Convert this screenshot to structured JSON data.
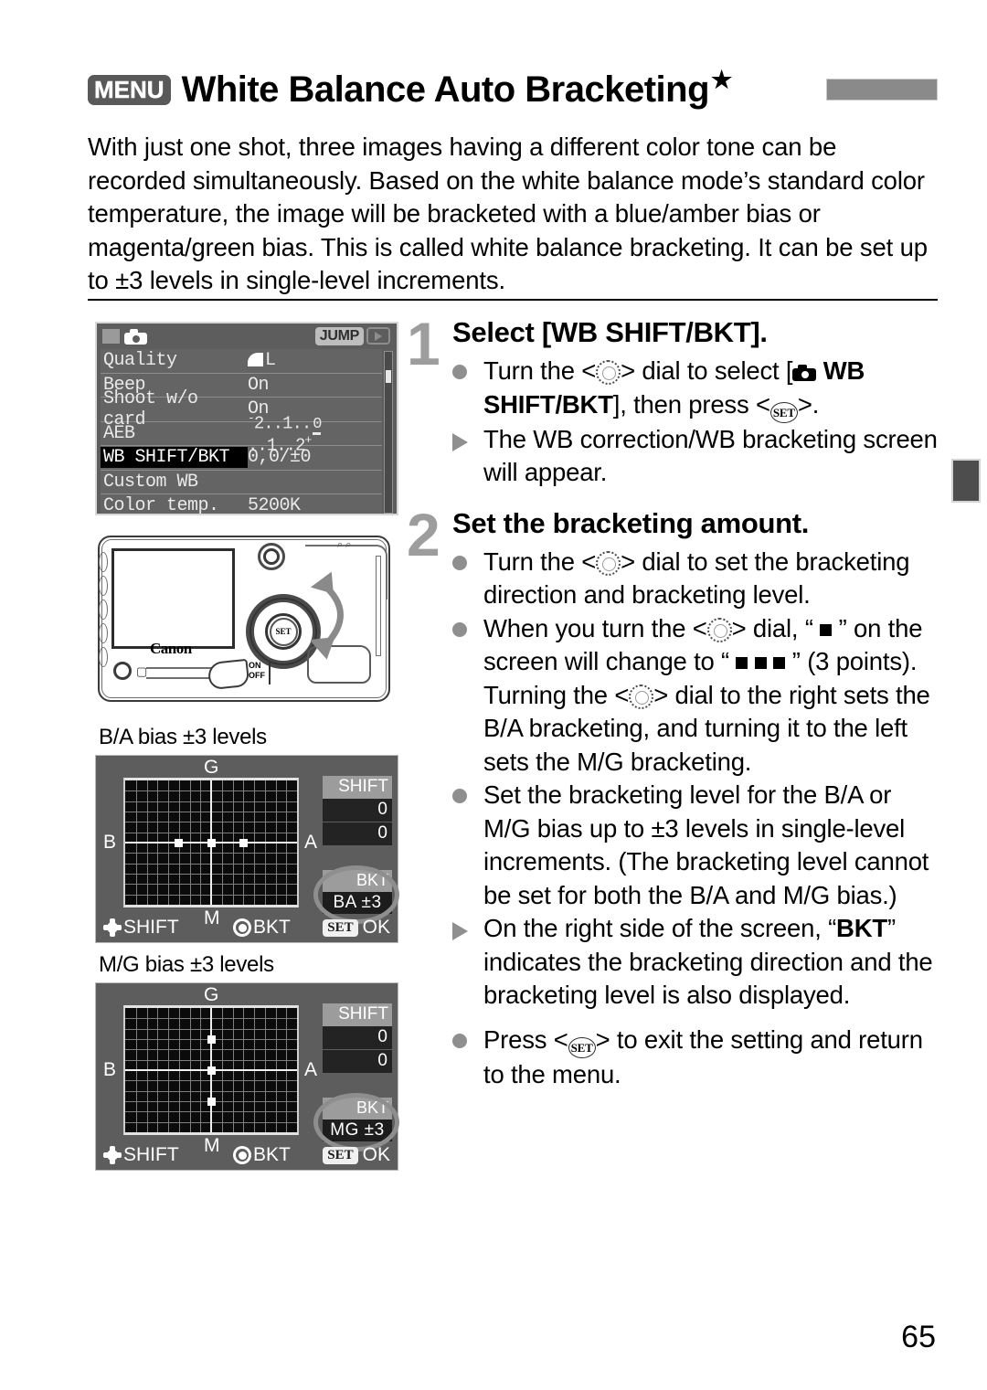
{
  "header": {
    "menu_badge": "MENU",
    "title": "White Balance Auto Bracketing",
    "star": "★"
  },
  "intro": "With just one shot, three images having a different color tone can be recorded simultaneously. Based on the white balance mode’s standard color temperature, the image will be bracketed with a blue/amber bias or magenta/green bias. This is called white balance bracketing. It can be set up to ±3 levels in single-level increments.",
  "menu_screen": {
    "jump_label": "JUMP",
    "rows": [
      {
        "label": "Quality",
        "value": "L"
      },
      {
        "label": "Beep",
        "value": "On"
      },
      {
        "label": "Shoot w/o card",
        "value": "On"
      },
      {
        "label": "AEB",
        "value": "-2..1..0..1..2+"
      },
      {
        "label": "WB SHIFT/BKT",
        "value": "0,0/±0"
      },
      {
        "label": "Custom WB",
        "value": ""
      },
      {
        "label": "Color temp.",
        "value": "5200K"
      }
    ],
    "selected_row": "WB SHIFT/BKT",
    "aeb_scale": {
      "left": "2",
      "mid_left": "1",
      "right_inner": "1",
      "right": "2"
    }
  },
  "camera_photo": {
    "brand": "Canon",
    "set_label": "SET",
    "power_on": "ON",
    "power_off": "OFF"
  },
  "wb_panels": [
    {
      "caption": "B/A bias ±3 levels",
      "axis": {
        "top": "G",
        "bottom": "M",
        "left": "B",
        "right": "A"
      },
      "shift_header": "SHIFT",
      "shift_values": [
        "0",
        "0"
      ],
      "bkt_header": "BKT",
      "bkt_value": "BA ±3",
      "footer": {
        "shift": "SHIFT",
        "bkt": "BKT",
        "set": "SET",
        "ok": "OK"
      },
      "points": [
        {
          "x": -3,
          "y": 0
        },
        {
          "x": 0,
          "y": 0
        },
        {
          "x": 3,
          "y": 0
        }
      ]
    },
    {
      "caption": "M/G bias ±3 levels",
      "axis": {
        "top": "G",
        "bottom": "M",
        "left": "B",
        "right": "A"
      },
      "shift_header": "SHIFT",
      "shift_values": [
        "0",
        "0"
      ],
      "bkt_header": "BKT",
      "bkt_value": "MG ±3",
      "footer": {
        "shift": "SHIFT",
        "bkt": "BKT",
        "set": "SET",
        "ok": "OK"
      },
      "points": [
        {
          "x": 0,
          "y": 3
        },
        {
          "x": 0,
          "y": 0
        },
        {
          "x": 0,
          "y": -3
        }
      ]
    }
  ],
  "steps": [
    {
      "number": "1",
      "heading": "Select [WB SHIFT/BKT].",
      "bullets": [
        {
          "marker": "dot",
          "parts": [
            {
              "t": "Turn the <"
            },
            {
              "icon": "dial"
            },
            {
              "t": "> dial to select ["
            },
            {
              "icon": "camera"
            },
            {
              "t": " ",
              "bold": true
            },
            {
              "t": "WB SHIFT/BKT",
              "bold": true
            },
            {
              "t": "], then press <"
            },
            {
              "icon": "set"
            },
            {
              "t": ">."
            }
          ]
        },
        {
          "marker": "triangle",
          "parts": [
            {
              "t": "The WB correction/WB bracketing screen will appear."
            }
          ]
        }
      ]
    },
    {
      "number": "2",
      "heading": "Set the bracketing amount.",
      "bullets": [
        {
          "marker": "dot",
          "parts": [
            {
              "t": "Turn the <"
            },
            {
              "icon": "dial"
            },
            {
              "t": "> dial to set the bracketing direction and bracketing level."
            }
          ]
        },
        {
          "marker": "dot",
          "parts": [
            {
              "t": "When you turn the <"
            },
            {
              "icon": "dial"
            },
            {
              "t": "> dial, “ "
            },
            {
              "icon": "square"
            },
            {
              "t": " ” on the screen will change to “ "
            },
            {
              "icon": "square"
            },
            {
              "t": " "
            },
            {
              "icon": "square"
            },
            {
              "t": " "
            },
            {
              "icon": "square"
            },
            {
              "t": " ” (3 points). Turning the <"
            },
            {
              "icon": "dial"
            },
            {
              "t": "> dial to the right sets the B/A bracketing, and turning it to the left sets the M/G bracketing."
            }
          ]
        },
        {
          "marker": "dot",
          "parts": [
            {
              "t": "Set the bracketing level for the B/A or M/G bias up to ±3 levels in single-level increments. (The bracketing level cannot be set for both the B/A and M/G bias.)"
            }
          ]
        },
        {
          "marker": "triangle",
          "parts": [
            {
              "t": "On the right side of the screen, “"
            },
            {
              "t": "BKT",
              "bold": true
            },
            {
              "t": "” indicates the bracketing direction and the bracketing level is also displayed."
            }
          ]
        },
        {
          "marker": "dot",
          "parts": [
            {
              "t": "Press <"
            },
            {
              "icon": "set"
            },
            {
              "t": "> to exit the setting and return to the menu."
            }
          ]
        }
      ]
    }
  ],
  "page_number": "65",
  "colors": {
    "accent_gray": "#8f8f8f",
    "lcd_bg": "#5d5d5d",
    "grid_bg": "#0b0b0b",
    "highlight": "#000000"
  }
}
